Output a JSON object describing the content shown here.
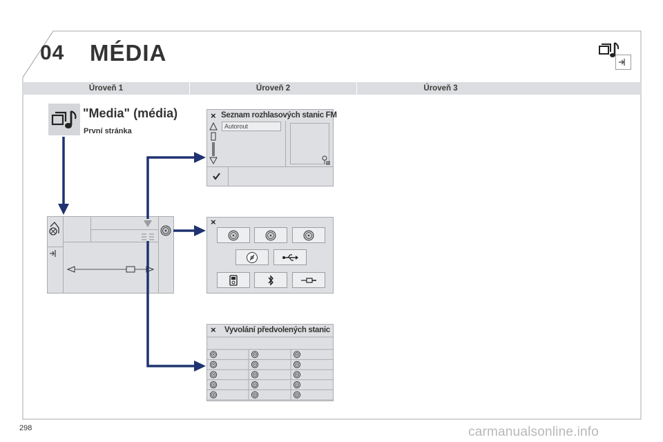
{
  "chapter": {
    "number": "04",
    "title": "MÉDIA"
  },
  "levels": [
    "Úroveň 1",
    "Úroveň 2",
    "Úroveň 3"
  ],
  "media": {
    "title": "\"Media\" (média)",
    "subtitle": "První stránka"
  },
  "fm_panel": {
    "title": "Seznam rozhlasových stanic FM",
    "field_value": "Autorout"
  },
  "presets_panel": {
    "title": "Vyvolání předvolených stanic",
    "rows": 5,
    "cols": 3
  },
  "page": {
    "number": "298"
  },
  "footer": {
    "watermark": "carmanualsonline.info"
  },
  "colors": {
    "arrow": "#1e3370",
    "screen": "#dedfe2",
    "levels_bar": "#dcdde0"
  },
  "icons": [
    "media-music-icon",
    "close-icon",
    "check-icon",
    "disc-icon",
    "usb-icon",
    "bluetooth-icon",
    "jack-icon",
    "ipod-icon",
    "radio-preset-icon",
    "source-icon",
    "exit-icon"
  ]
}
